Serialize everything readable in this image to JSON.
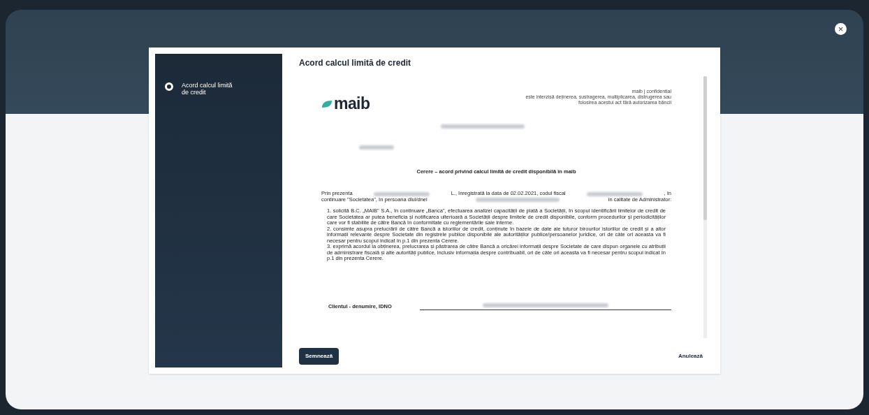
{
  "close_button": {
    "label": "×"
  },
  "sidebar": {
    "steps": [
      {
        "label": "Acord calcul limită de credit",
        "selected": true
      }
    ]
  },
  "dialog": {
    "title": "Acord calcul limită de credit"
  },
  "document": {
    "logo": "maib",
    "header_note": [
      "maib | confidential",
      "este interzisă deținerea, sustragerea, multiplicarea, distrugerea sau",
      "folosirea acestui act fără autorizarea băncii"
    ],
    "heading": "Cerere – acord privind calcul limită de credit disponibilă în maib",
    "intro_lines": [
      [
        "Prin prezenta",
        "L., înregistrată la data de 02.02.2021, codul fiscal",
        ", în"
      ],
      [
        "continuare \"Societatea\", în persoana dlui/dnei",
        "în calitate de Administrator:"
      ]
    ],
    "clauses": [
      "1. solicită B.C. „MAIB\" S.A., în continuare „Banca\", efectuarea analizei capacității de plată a Societății, în scopul identificării limitelor de credit de care Societatea ar putea beneficia și notificarea ulterioară a Societății despre limitele de credit disponibile, conform procedurilor și periodicităților care vor fi stabilite de către Bancă în conformitate cu reglementările sale interne.",
      "2. consimte asupra prelucrării de către Bancă a istoriilor de credit, conținute în bazele de date ale tuturor birourilor istoriilor de credit și a altor informații relevante despre Societate din registrele publice disponibile ale autorităților publice/persoanelor juridice, ori de câte ori aceasta va fi necesar pentru scopul indicat în p.1 din prezenta Cerere.",
      "3. exprimă acordul la obținerea, prelucrarea și păstrarea de către Bancă a oricărei informații despre Societate de care dispun organele cu atribuții de administrare fiscală și alte autorități publice, inclusiv informația despre contribuabil, ori de câte ori aceasta va fi necesar pentru scopul indicat în p.1 din prezenta Cerere."
    ],
    "signature_label": "Clientul - denumire, IDNO"
  },
  "actions": {
    "primary": "Semnează",
    "secondary": "Anulează"
  }
}
